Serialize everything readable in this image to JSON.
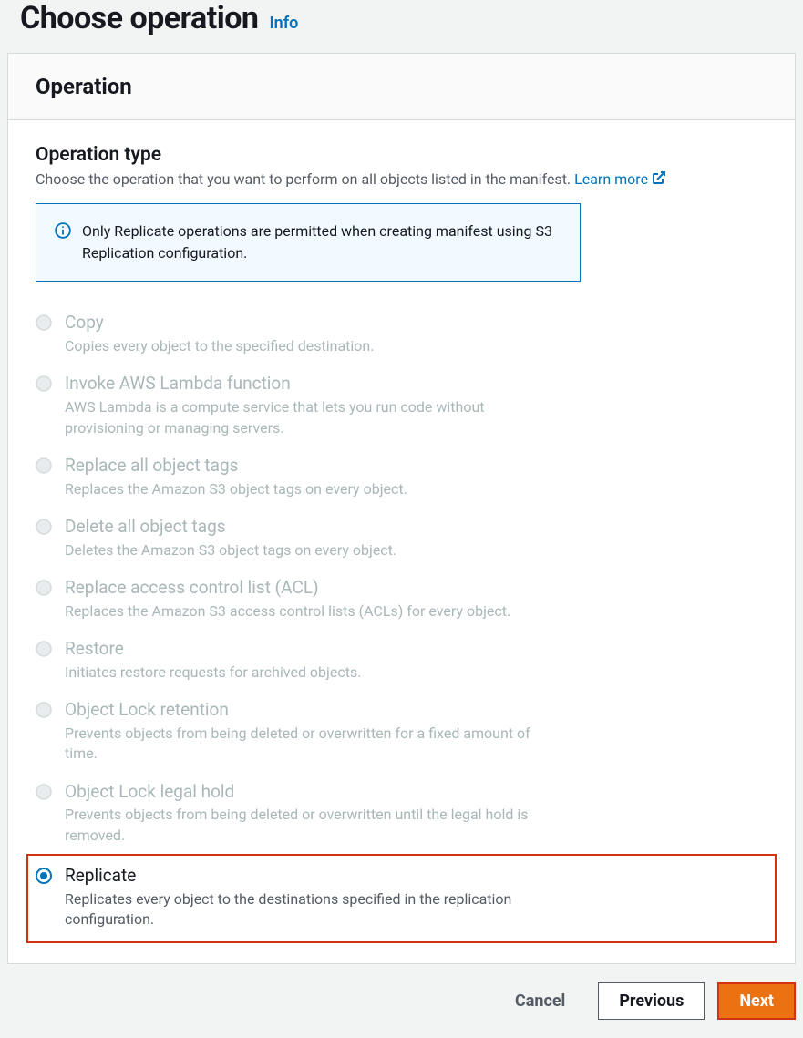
{
  "header": {
    "title": "Choose operation",
    "info": "Info"
  },
  "panel": {
    "title": "Operation"
  },
  "section": {
    "label": "Operation type",
    "desc": "Choose the operation that you want to perform on all objects listed in the manifest. ",
    "learn_more": "Learn more"
  },
  "alert": {
    "text": "Only Replicate operations are permitted when creating manifest using S3 Replication configuration."
  },
  "options": [
    {
      "title": "Copy",
      "desc": "Copies every object to the specified destination."
    },
    {
      "title": "Invoke AWS Lambda function",
      "desc": "AWS Lambda is a compute service that lets you run code without provisioning or managing servers."
    },
    {
      "title": "Replace all object tags",
      "desc": "Replaces the Amazon S3 object tags on every object."
    },
    {
      "title": "Delete all object tags",
      "desc": "Deletes the Amazon S3 object tags on every object."
    },
    {
      "title": "Replace access control list (ACL)",
      "desc": "Replaces the Amazon S3 access control lists (ACLs) for every object."
    },
    {
      "title": "Restore",
      "desc": "Initiates restore requests for archived objects."
    },
    {
      "title": "Object Lock retention",
      "desc": "Prevents objects from being deleted or overwritten for a fixed amount of time."
    },
    {
      "title": "Object Lock legal hold",
      "desc": "Prevents objects from being deleted or overwritten until the legal hold is removed."
    },
    {
      "title": "Replicate",
      "desc": "Replicates every object to the destinations specified in the replication configuration."
    }
  ],
  "footer": {
    "cancel": "Cancel",
    "previous": "Previous",
    "next": "Next"
  }
}
